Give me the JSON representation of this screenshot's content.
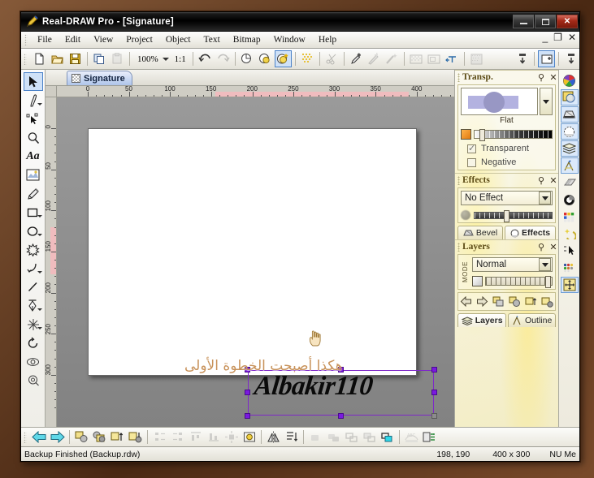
{
  "window": {
    "title": "Real-DRAW Pro - [Signature]",
    "app_icon": "pen-icon",
    "controls": {
      "minimize": "–",
      "maximize": "□",
      "close": "✕"
    }
  },
  "menu": {
    "items": [
      {
        "label": "File",
        "accel": "F"
      },
      {
        "label": "Edit",
        "accel": "E"
      },
      {
        "label": "View",
        "accel": "V"
      },
      {
        "label": "Project",
        "accel": "P"
      },
      {
        "label": "Object",
        "accel": "O"
      },
      {
        "label": "Text",
        "accel": "T"
      },
      {
        "label": "Bitmap",
        "accel": "m"
      },
      {
        "label": "Window",
        "accel": "W"
      },
      {
        "label": "Help",
        "accel": "H"
      }
    ],
    "mdi_controls": {
      "minimize": "_",
      "restore": "❐",
      "close": "✕"
    }
  },
  "toolbar": {
    "zoom_value": "100%",
    "ratio_label": "1:1",
    "buttons": [
      "new-document-icon",
      "open-folder-icon",
      "save-disk-icon",
      "copy-icon",
      "paste-icon",
      "undo-icon",
      "redo-icon",
      "object-no-shadow-icon",
      "object-shadow-icon",
      "object-glow-icon",
      "dither-pattern-icon",
      "scissors-icon",
      "eyedropper-icon",
      "magic-brush-icon",
      "magic-wand-icon",
      "transparency-grid-icon",
      "frame-icon",
      "text-wrap-icon",
      "halftone-icon",
      "align-top-icon",
      "insert-page-icon",
      "align-bottom-icon"
    ]
  },
  "left_tools": {
    "items": [
      {
        "name": "pointer-tool",
        "active": true,
        "has_submenu": false
      },
      {
        "name": "brush-tool",
        "active": false,
        "has_submenu": true
      },
      {
        "name": "node-edit-tool",
        "active": false,
        "has_submenu": false
      },
      {
        "name": "zoom-tool",
        "active": false,
        "has_submenu": false
      },
      {
        "name": "text-tool",
        "active": false,
        "has_submenu": false,
        "glyph": "Aa"
      },
      {
        "name": "bitmap-tool",
        "active": false,
        "has_submenu": false
      },
      {
        "name": "paint-tool",
        "active": false,
        "has_submenu": false
      },
      {
        "name": "rectangle-tool",
        "active": false,
        "has_submenu": true
      },
      {
        "name": "ellipse-tool",
        "active": false,
        "has_submenu": true
      },
      {
        "name": "star-tool",
        "active": false,
        "has_submenu": false
      },
      {
        "name": "curve-tool",
        "active": false,
        "has_submenu": true
      },
      {
        "name": "line-tool",
        "active": false,
        "has_submenu": false
      },
      {
        "name": "pen-tool",
        "active": false,
        "has_submenu": true
      },
      {
        "name": "sparkle-tool",
        "active": false,
        "has_submenu": true
      },
      {
        "name": "rotate-tool",
        "active": false,
        "has_submenu": false
      },
      {
        "name": "lens-tool",
        "active": false,
        "has_submenu": false
      },
      {
        "name": "target-tool",
        "active": false,
        "has_submenu": false
      }
    ]
  },
  "document": {
    "tab_label": "Signature",
    "tab_icon": "checker-thumbnail-icon",
    "page_size": "400 x 300",
    "h_ruler_labels": [
      "0",
      "50",
      "100",
      "150",
      "200",
      "250",
      "300",
      "350",
      "400"
    ],
    "v_ruler_labels": [
      "0",
      "50",
      "100",
      "150",
      "200",
      "250",
      "300"
    ],
    "signature_text": "Albakir110",
    "arabic_text": "هكذا أصبحت الخطوة الأولى",
    "arabic_color": "#c8925a",
    "selection_color": "#7a19e0",
    "cursor": "hand-cursor"
  },
  "panels": {
    "transparency": {
      "title": "Transp.",
      "pin_icon": "pin-icon",
      "close_icon": "close-icon",
      "preview_label": "Flat",
      "checkboxes": [
        {
          "label": "Transparent",
          "checked": true
        },
        {
          "label": "Negative",
          "checked": false
        }
      ]
    },
    "effects": {
      "title": "Effects",
      "pin_icon": "pin-icon",
      "close_icon": "close-icon",
      "selected_effect": "No Effect",
      "tabs": [
        {
          "label": "Bevel",
          "icon": "bevel-icon",
          "selected": false
        },
        {
          "label": "Effects",
          "icon": "effects-icon",
          "selected": true
        }
      ]
    },
    "layers": {
      "title": "Layers",
      "pin_icon": "pin-icon",
      "close_icon": "close-icon",
      "mode_label": "MODE",
      "blend_mode": "Normal",
      "buttons": [
        "move-left-icon",
        "move-right-icon",
        "group-icon",
        "duplicate-icon",
        "raise-layer-icon",
        "lower-layer-icon"
      ],
      "tabs": [
        {
          "label": "Layers",
          "icon": "layers-icon",
          "selected": true
        },
        {
          "label": "Outline",
          "icon": "outline-icon",
          "selected": false
        }
      ]
    }
  },
  "icon_strip": {
    "items": [
      {
        "name": "color-wheel-icon",
        "boxed": false
      },
      {
        "name": "transparency-icon",
        "boxed": true
      },
      {
        "name": "bevel-icon",
        "boxed": true
      },
      {
        "name": "effects-icon",
        "boxed": true
      },
      {
        "name": "layers-icon",
        "boxed": true
      },
      {
        "name": "outline-icon",
        "boxed": true
      },
      {
        "name": "gradient-plane-icon",
        "boxed": false
      },
      {
        "name": "light-sphere-icon",
        "boxed": false
      },
      {
        "name": "palette-grid-icon",
        "boxed": false
      },
      {
        "name": "magic-effects-icon",
        "boxed": false
      },
      {
        "name": "pointer-strip-icon",
        "boxed": false
      },
      {
        "name": "color-dots-icon",
        "boxed": false
      },
      {
        "name": "move-handles-icon",
        "boxed": true
      }
    ]
  },
  "bottom_toolbar": {
    "buttons": [
      "arrow-back-icon",
      "arrow-forward-icon",
      "to-front-icon",
      "to-back-icon",
      "forward-one-icon",
      "back-one-icon",
      "align-left-icon",
      "align-right-icon",
      "align-top-icon",
      "align-bottom-icon",
      "center-icon",
      "center-object-icon",
      "mirror-horizontal-icon",
      "distribute-icon",
      "combine-icon",
      "weld-icon",
      "intersect-icon",
      "trim-icon",
      "merge-icon",
      "text-on-path-icon",
      "export-icon"
    ]
  },
  "statusbar": {
    "message": "Backup Finished (Backup.rdw)",
    "coordinates": "198, 190",
    "dimensions": "400 x 300",
    "extra": "NU Me"
  }
}
